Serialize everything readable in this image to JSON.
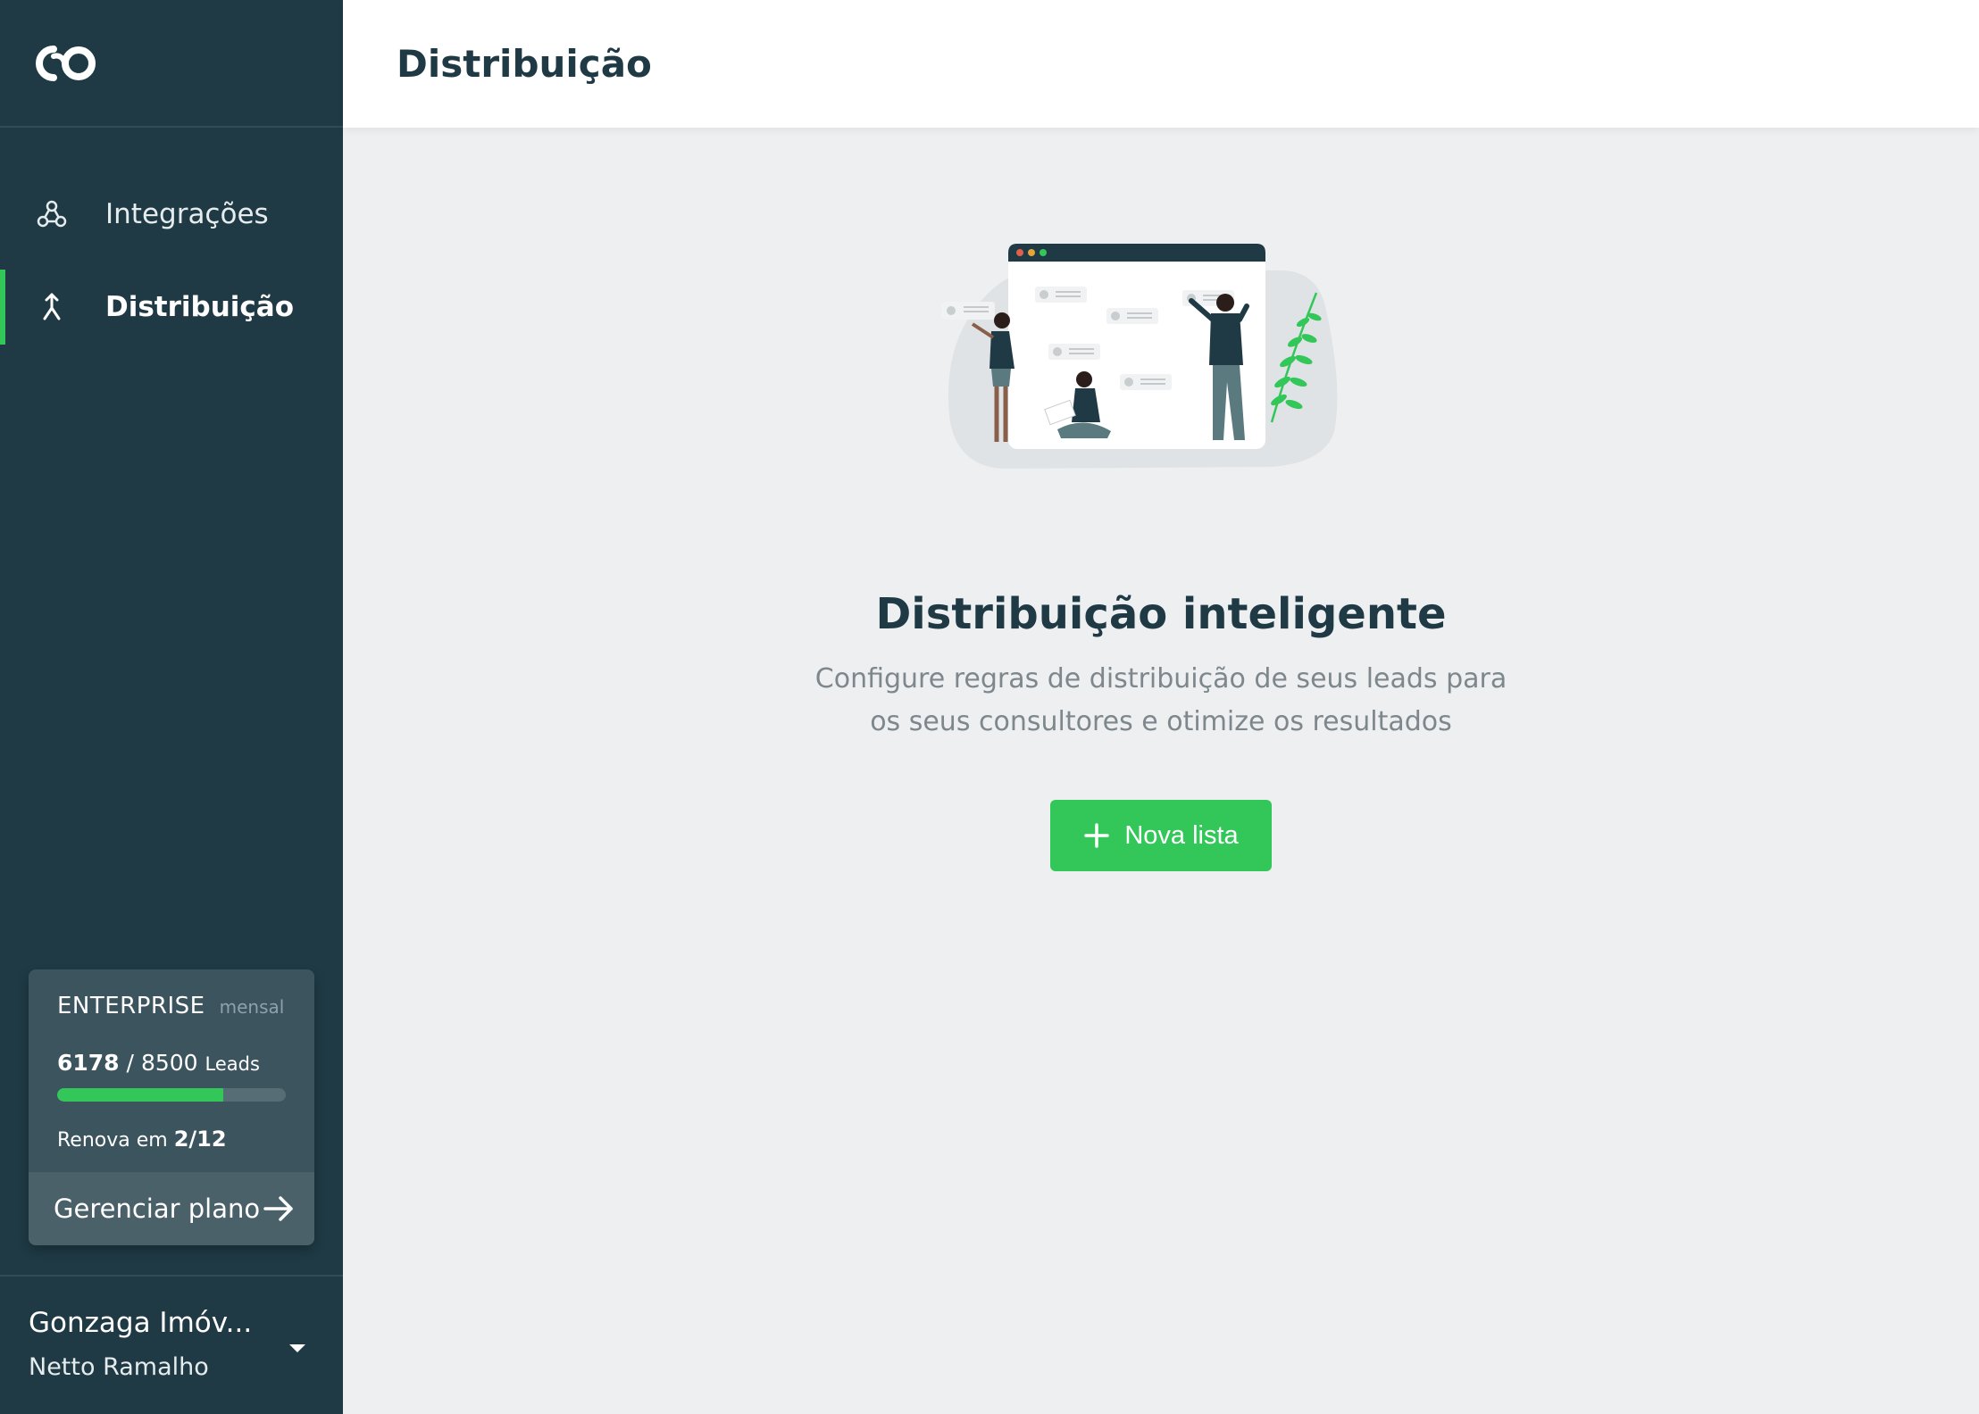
{
  "app": {
    "logo_icon": "co-logo-icon"
  },
  "sidebar": {
    "items": [
      {
        "label": "Integrações",
        "icon": "webhook-icon",
        "active": false
      },
      {
        "label": "Distribuição",
        "icon": "merge-arrow-icon",
        "active": true
      }
    ]
  },
  "plan": {
    "name": "ENTERPRISE",
    "period": "mensal",
    "leads_used": "6178",
    "separator": "/",
    "leads_total": "8500",
    "leads_word": "Leads",
    "usage_fraction": 0.727,
    "renew_prefix": "Renova em",
    "renew_date": "2/12",
    "manage_label": "Gerenciar plano",
    "manage_icon": "arrow-right-icon"
  },
  "account": {
    "company": "Gonzaga Imóv...",
    "user": "Netto Ramalho",
    "caret_icon": "caret-down-icon"
  },
  "header": {
    "title": "Distribuição"
  },
  "empty_state": {
    "title": "Distribuição inteligente",
    "desc_line1": "Configure regras de distribuição de seus leads para",
    "desc_line2": "os seus consultores e otimize os resultados",
    "button_label": "Nova lista",
    "button_icon": "plus-icon"
  },
  "colors": {
    "sidebar_bg": "#1f3a45",
    "accent": "#33c75a",
    "content_bg": "#edeff1",
    "title": "#1f3a45"
  }
}
